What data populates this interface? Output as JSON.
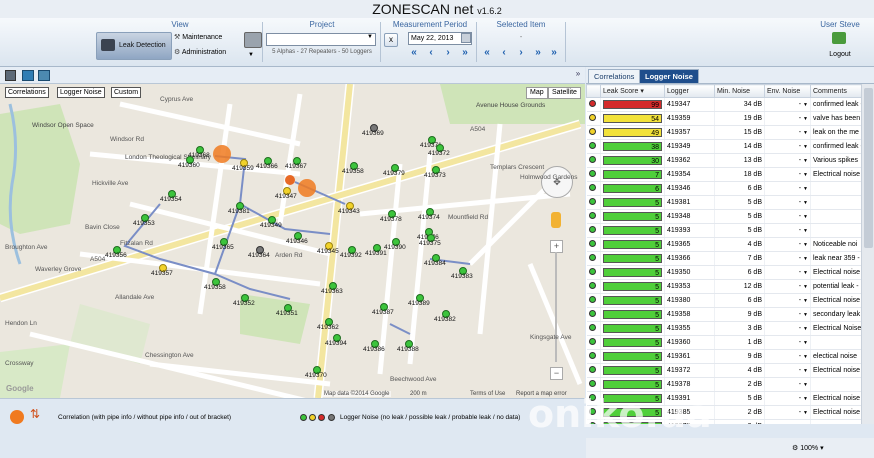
{
  "app": {
    "title": "ZONESCAN net",
    "version": "v1.6.2",
    "user_label": "User Steve"
  },
  "ribbon": {
    "view_title": "View",
    "leak_detection": "Leak Detection",
    "maintenance": "Maintenance",
    "administration": "Administration",
    "project_title": "Project",
    "project_summary": "5 Alphas - 27 Repeaters - 50 Loggers",
    "measurement_title": "Measurement Period",
    "measurement_date": "May 22, 2013",
    "selected_item_title": "Selected Item",
    "selected_item_value": "-",
    "logout": "Logout"
  },
  "map": {
    "tabs": [
      "Correlations",
      "Logger Noise",
      "Custom"
    ],
    "map_type_buttons": [
      "Map",
      "Satellite"
    ],
    "attribution": "Map data ©2014 Google",
    "scale": "200 m",
    "terms": "Terms of Use",
    "report": "Report a map error",
    "google": "Google",
    "places": [
      {
        "label": "Windsor\nOpen Space"
      },
      {
        "label": "London\nTheological\nSeminary"
      },
      {
        "label": "Avenue House\nGrounds"
      },
      {
        "label": "Cycling"
      }
    ],
    "streets": [
      "Cyprus Ave",
      "Windsor Rd",
      "Hickville Ave",
      "Fitzalan Rd",
      "Arden Rd",
      "Waverley Grove",
      "Allandale Ave",
      "Hendon Ln",
      "Crossway",
      "Chessington Ave",
      "Beechwood Ave",
      "Mountfield Rd",
      "Templars Crescent",
      "Holmwood Gardens",
      "A504",
      "Broughton Ave",
      "Bavin Close",
      "A504",
      "Kingsgate Ave"
    ],
    "loggers": [
      {
        "id": "419369",
        "color": "gray"
      },
      {
        "id": "419371",
        "color": "green"
      },
      {
        "id": "419372",
        "color": "green"
      },
      {
        "id": "419368",
        "color": "green"
      },
      {
        "id": "419360",
        "color": "green"
      },
      {
        "id": "419359",
        "color": "yellow"
      },
      {
        "id": "419366",
        "color": "green"
      },
      {
        "id": "419367",
        "color": "green"
      },
      {
        "id": "419358",
        "color": "green"
      },
      {
        "id": "419379",
        "color": "green"
      },
      {
        "id": "419373",
        "color": "green"
      },
      {
        "id": "419354",
        "color": "green"
      },
      {
        "id": "419347",
        "color": "yellow"
      },
      {
        "id": "419381",
        "color": "green"
      },
      {
        "id": "419343",
        "color": "yellow"
      },
      {
        "id": "419378",
        "color": "green"
      },
      {
        "id": "419374",
        "color": "green"
      },
      {
        "id": "419353",
        "color": "green"
      },
      {
        "id": "419349",
        "color": "green"
      },
      {
        "id": "419346",
        "color": "green"
      },
      {
        "id": "419376",
        "color": "green"
      },
      {
        "id": "419375",
        "color": "green"
      },
      {
        "id": "419356",
        "color": "green"
      },
      {
        "id": "419365",
        "color": "green"
      },
      {
        "id": "419364",
        "color": "gray"
      },
      {
        "id": "419345",
        "color": "yellow"
      },
      {
        "id": "419392",
        "color": "green"
      },
      {
        "id": "419391",
        "color": "green"
      },
      {
        "id": "419390",
        "color": "green"
      },
      {
        "id": "419384",
        "color": "green"
      },
      {
        "id": "419357",
        "color": "yellow"
      },
      {
        "id": "419383",
        "color": "green"
      },
      {
        "id": "419358",
        "color": "green"
      },
      {
        "id": "419363",
        "color": "green"
      },
      {
        "id": "419389",
        "color": "green"
      },
      {
        "id": "419352",
        "color": "green"
      },
      {
        "id": "419351",
        "color": "green"
      },
      {
        "id": "419387",
        "color": "green"
      },
      {
        "id": "419382",
        "color": "green"
      },
      {
        "id": "419362",
        "color": "green"
      },
      {
        "id": "419394",
        "color": "green"
      },
      {
        "id": "419386",
        "color": "green"
      },
      {
        "id": "419388",
        "color": "green"
      },
      {
        "id": "419370",
        "color": "green"
      }
    ]
  },
  "legend": {
    "correlation": "Correlation (with pipe info / without pipe info / out of bracket)",
    "logger_noise": "Logger Noise (no leak / possible leak / probable leak / no data)"
  },
  "panel": {
    "tabs": [
      "Correlations",
      "Logger Noise"
    ],
    "columns": [
      "Leak Score",
      "Logger",
      "Min. Noise",
      "Env. Noise",
      "Comments"
    ],
    "rows": [
      {
        "status": "red",
        "score": 99,
        "logger": "419347",
        "min": "34 dB",
        "env": "-",
        "comment": "confirmed leak -"
      },
      {
        "status": "yellow",
        "score": 54,
        "logger": "419359",
        "min": "19 dB",
        "env": "-",
        "comment": "valve has been"
      },
      {
        "status": "yellow",
        "score": 49,
        "logger": "419357",
        "min": "15 dB",
        "env": "-",
        "comment": "leak on the me"
      },
      {
        "status": "green",
        "score": 38,
        "logger": "419349",
        "min": "14 dB",
        "env": "-",
        "comment": "confirmed leak -"
      },
      {
        "status": "green",
        "score": 30,
        "logger": "419362",
        "min": "13 dB",
        "env": "-",
        "comment": "Various spikes"
      },
      {
        "status": "green",
        "score": 7,
        "logger": "419354",
        "min": "18 dB",
        "env": "-",
        "comment": "Electrical noise"
      },
      {
        "status": "green",
        "score": 6,
        "logger": "419346",
        "min": "6 dB",
        "env": "-",
        "comment": ""
      },
      {
        "status": "green",
        "score": 5,
        "logger": "419381",
        "min": "5 dB",
        "env": "-",
        "comment": ""
      },
      {
        "status": "green",
        "score": 5,
        "logger": "419348",
        "min": "5 dB",
        "env": "-",
        "comment": ""
      },
      {
        "status": "green",
        "score": 5,
        "logger": "419393",
        "min": "5 dB",
        "env": "-",
        "comment": ""
      },
      {
        "status": "green",
        "score": 5,
        "logger": "419365",
        "min": "4 dB",
        "env": "-",
        "comment": "Noticeable noi"
      },
      {
        "status": "green",
        "score": 5,
        "logger": "419366",
        "min": "7 dB",
        "env": "-",
        "comment": "leak near 359 -"
      },
      {
        "status": "green",
        "score": 5,
        "logger": "419350",
        "min": "6 dB",
        "env": "-",
        "comment": "Electrical noise"
      },
      {
        "status": "green",
        "score": 5,
        "logger": "419353",
        "min": "12 dB",
        "env": "-",
        "comment": "potential leak -"
      },
      {
        "status": "green",
        "score": 5,
        "logger": "419380",
        "min": "6 dB",
        "env": "-",
        "comment": "Electrical noise"
      },
      {
        "status": "green",
        "score": 5,
        "logger": "419358",
        "min": "9 dB",
        "env": "-",
        "comment": "secondary leak"
      },
      {
        "status": "green",
        "score": 5,
        "logger": "419355",
        "min": "3 dB",
        "env": "-",
        "comment": "Electrical Noise"
      },
      {
        "status": "green",
        "score": 5,
        "logger": "419360",
        "min": "1 dB",
        "env": "-",
        "comment": ""
      },
      {
        "status": "green",
        "score": 5,
        "logger": "419361",
        "min": "9 dB",
        "env": "-",
        "comment": "electical noise"
      },
      {
        "status": "green",
        "score": 5,
        "logger": "419372",
        "min": "4 dB",
        "env": "-",
        "comment": "Electrical noise"
      },
      {
        "status": "green",
        "score": 5,
        "logger": "419378",
        "min": "2 dB",
        "env": "-",
        "comment": ""
      },
      {
        "status": "green",
        "score": 5,
        "logger": "419391",
        "min": "5 dB",
        "env": "-",
        "comment": "Electrical noise"
      },
      {
        "status": "green",
        "score": 5,
        "logger": "419385",
        "min": "2 dB",
        "env": "-",
        "comment": "Electrical noise"
      },
      {
        "status": "green",
        "score": 5,
        "logger": "419377",
        "min": "3 dB",
        "env": "-",
        "comment": ""
      },
      {
        "status": "green",
        "score": 5,
        "logger": "419389",
        "min": "2 dB",
        "env": "-",
        "comment": ""
      }
    ]
  },
  "status": {
    "zoom": "100%"
  },
  "watermark": "oniko.ua",
  "colors": {
    "bar_red": "#d42a2a",
    "bar_yellow": "#f2e23a",
    "bar_green": "#4fcf3a",
    "accent": "#1f4e8c"
  }
}
